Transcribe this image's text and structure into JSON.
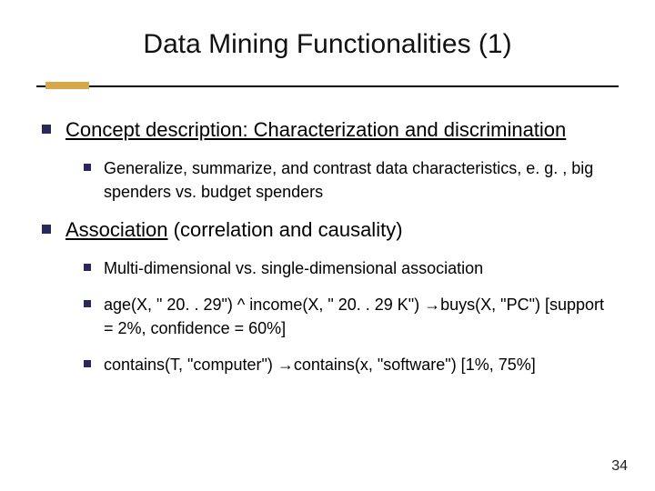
{
  "title": "Data Mining Functionalities (1)",
  "sections": [
    {
      "heading": "Concept description: Characterization and discrimination",
      "heading_underlined": true,
      "items": [
        "Generalize, summarize, and contrast data characteristics, e. g. , big spenders vs. budget spenders"
      ]
    },
    {
      "heading_parts": {
        "u": "Association",
        "rest": " (correlation and causality)"
      },
      "items": [
        "Multi-dimensional vs. single-dimensional association",
        "age(X, \" 20. . 29\") ^ income(X, \" 20. . 29 K\") →buys(X, \"PC\") [support = 2%, confidence = 60%]",
        "contains(T, \"computer\") →contains(x, \"software\") [1%, 75%]"
      ]
    }
  ],
  "page_number": "34"
}
